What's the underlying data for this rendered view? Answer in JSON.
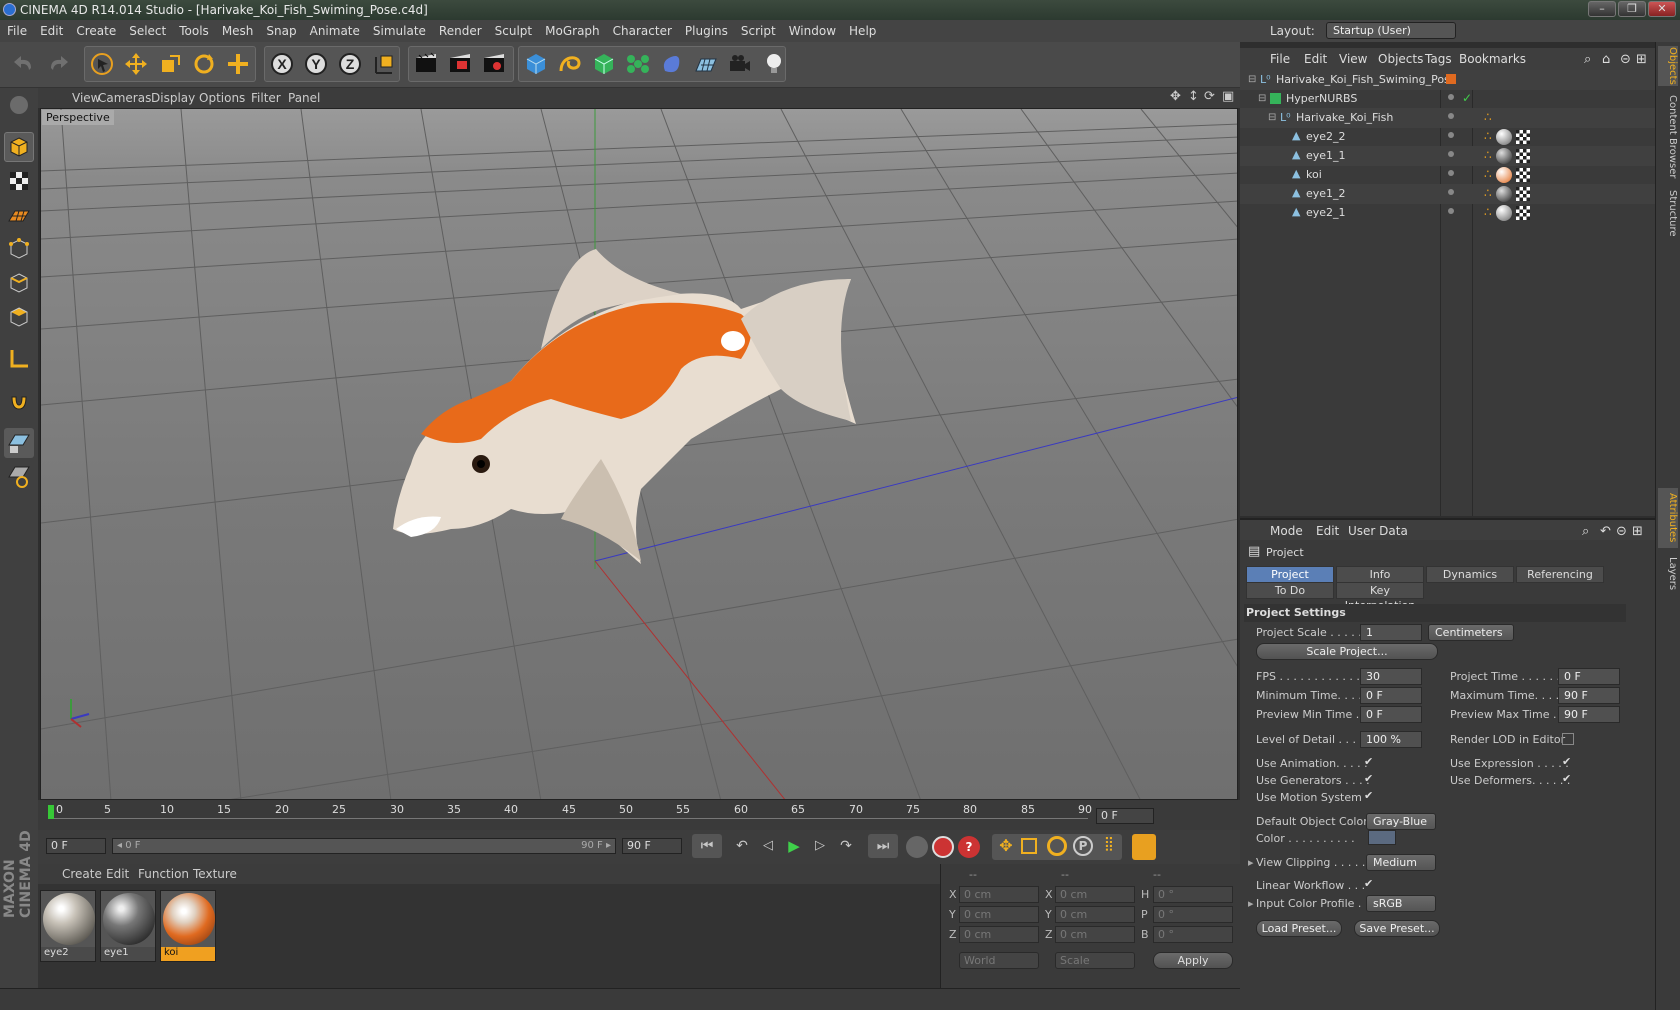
{
  "window": {
    "title": "CINEMA 4D R14.014 Studio - [Harivake_Koi_Fish_Swiming_Pose.c4d]",
    "min": "–",
    "max": "❐",
    "close": "✕"
  },
  "menu": [
    "File",
    "Edit",
    "Create",
    "Select",
    "Tools",
    "Mesh",
    "Snap",
    "Animate",
    "Simulate",
    "Render",
    "Sculpt",
    "MoGraph",
    "Character",
    "Plugins",
    "Script",
    "Window",
    "Help"
  ],
  "layout": {
    "label": "Layout:",
    "value": "Startup (User)"
  },
  "viewport": {
    "menu": [
      "View",
      "Cameras",
      "Display",
      "Options",
      "Filter",
      "Panel"
    ],
    "label": "Perspective"
  },
  "timeline": {
    "ticks": [
      "0",
      "5",
      "10",
      "15",
      "20",
      "25",
      "30",
      "35",
      "40",
      "45",
      "50",
      "55",
      "60",
      "65",
      "70",
      "75",
      "80",
      "85",
      "90"
    ],
    "end_field": "0 F"
  },
  "playback": {
    "current": "0 F",
    "range_start": "◂ 0 F",
    "range_end": "90 F ▸",
    "max": "90 F"
  },
  "materials": {
    "menu": [
      "Create",
      "Edit",
      "Function",
      "Texture"
    ],
    "items": [
      "eye2",
      "eye1",
      "koi"
    ]
  },
  "coords": {
    "headers": [
      "--",
      "--",
      "--"
    ],
    "rows": [
      {
        "a": "X",
        "av": "0 cm",
        "b": "X",
        "bv": "0 cm",
        "c": "H",
        "cv": "0 °"
      },
      {
        "a": "Y",
        "av": "0 cm",
        "b": "Y",
        "bv": "0 cm",
        "c": "P",
        "cv": "0 °"
      },
      {
        "a": "Z",
        "av": "0 cm",
        "b": "Z",
        "bv": "0 cm",
        "c": "B",
        "cv": "0 °"
      }
    ],
    "world": "World",
    "scale": "Scale",
    "apply": "Apply"
  },
  "objects": {
    "menu": [
      "File",
      "Edit",
      "View",
      "Objects",
      "Tags",
      "Bookmarks"
    ],
    "tree": [
      "Harivake_Koi_Fish_Swiming_Pose",
      "HyperNURBS",
      "Harivake_Koi_Fish",
      "eye2_2",
      "eye1_1",
      "koi",
      "eye1_2",
      "eye2_1"
    ]
  },
  "attributes": {
    "menu": [
      "Mode",
      "Edit",
      "User Data"
    ],
    "header": "Project",
    "tabs": [
      "Project Settings",
      "Info",
      "Dynamics",
      "Referencing",
      "To Do",
      "Key Interpolation"
    ],
    "section": "Project Settings",
    "project_scale": {
      "label": "Project Scale . . . . . .",
      "value": "1",
      "unit": "Centimeters"
    },
    "scale_project": "Scale Project...",
    "fps": {
      "label": "FPS . . . . . . . . . . . . . .",
      "value": "30"
    },
    "project_time": {
      "label": "Project Time . . . . . . . .",
      "value": "0 F"
    },
    "min_time": {
      "label": "Minimum Time. . . . .",
      "value": "0 F"
    },
    "max_time": {
      "label": "Maximum Time. . . . . .",
      "value": "90 F"
    },
    "prev_min": {
      "label": "Preview Min Time . .",
      "value": "0 F"
    },
    "prev_max": {
      "label": "Preview Max Time . . .",
      "value": "90 F"
    },
    "lod": {
      "label": "Level of Detail . . . . .",
      "value": "100 %"
    },
    "render_lod": "Render LOD in Editor",
    "use_animation": "Use Animation. . . . .",
    "use_expression": "Use Expression . . . . .",
    "use_generators": "Use Generators . . . .",
    "use_deformers": "Use Deformers. . . . . .",
    "use_motion": "Use Motion System",
    "default_color": {
      "label": "Default Object Color",
      "value": "Gray-Blue"
    },
    "color": "Color . . . . . . . . . .",
    "view_clipping": {
      "label": "View Clipping . . . . .",
      "value": "Medium"
    },
    "linear_workflow": "Linear Workflow . . .",
    "input_profile": {
      "label": "Input Color Profile .",
      "value": "sRGB"
    },
    "load_preset": "Load Preset...",
    "save_preset": "Save Preset..."
  },
  "side_tabs": [
    "Objects",
    "Content Browser",
    "Structure",
    "Attributes",
    "Layers"
  ],
  "brand": "MAXON CINEMA 4D"
}
